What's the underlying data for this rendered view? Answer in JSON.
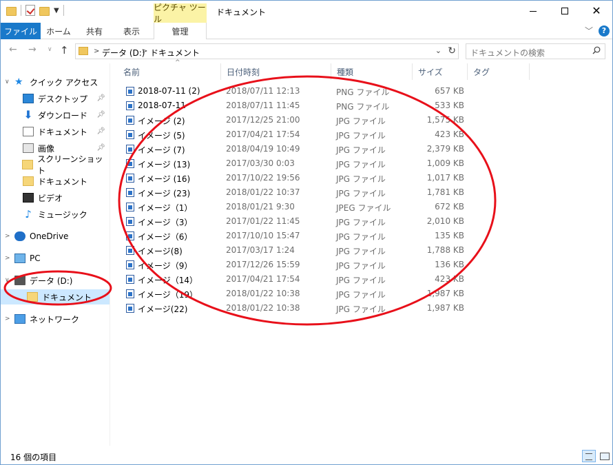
{
  "window": {
    "title": "ドキュメント",
    "context_tab": "ピクチャ ツール"
  },
  "ribbon": {
    "tabs": [
      "ファイル",
      "ホーム",
      "共有",
      "表示",
      "管理"
    ]
  },
  "address": {
    "crumbs": [
      "データ (D:)",
      "ドキュメント"
    ],
    "search_placeholder": "ドキュメントの検索"
  },
  "nav": {
    "quick_access": "クイック アクセス",
    "items": [
      {
        "label": "デスクトップ",
        "icon": "desktop-icon",
        "pinned": true
      },
      {
        "label": "ダウンロード",
        "icon": "download-icon",
        "pinned": true
      },
      {
        "label": "ドキュメント",
        "icon": "document-icon",
        "pinned": true
      },
      {
        "label": "画像",
        "icon": "pictures-icon",
        "pinned": true
      },
      {
        "label": "スクリーンショット",
        "icon": "folder-icon",
        "pinned": false
      },
      {
        "label": "ドキュメント",
        "icon": "folder-icon",
        "pinned": false
      },
      {
        "label": "ビデオ",
        "icon": "video-icon",
        "pinned": false
      },
      {
        "label": "ミュージック",
        "icon": "music-icon",
        "pinned": false
      }
    ],
    "onedrive": "OneDrive",
    "pc": "PC",
    "drive": "データ (D:)",
    "drive_child": "ドキュメント",
    "network": "ネットワーク"
  },
  "columns": {
    "name": "名前",
    "date": "日付時刻",
    "type": "種類",
    "size": "サイズ",
    "tag": "タグ"
  },
  "files": [
    {
      "name": "2018-07-11 (2)",
      "date": "2018/07/11 12:13",
      "type": "PNG ファイル",
      "size": "657 KB"
    },
    {
      "name": "2018-07-11",
      "date": "2018/07/11 11:45",
      "type": "PNG ファイル",
      "size": "533 KB"
    },
    {
      "name": "イメージ (2)",
      "date": "2017/12/25 21:00",
      "type": "JPG ファイル",
      "size": "1,575 KB"
    },
    {
      "name": "イメージ (5)",
      "date": "2017/04/21 17:54",
      "type": "JPG ファイル",
      "size": "423 KB"
    },
    {
      "name": "イメージ (7)",
      "date": "2018/04/19 10:49",
      "type": "JPG ファイル",
      "size": "2,379 KB"
    },
    {
      "name": "イメージ (13)",
      "date": "2017/03/30 0:03",
      "type": "JPG ファイル",
      "size": "1,009 KB"
    },
    {
      "name": "イメージ (16)",
      "date": "2017/10/22 19:56",
      "type": "JPG ファイル",
      "size": "1,017 KB"
    },
    {
      "name": "イメージ (23)",
      "date": "2018/01/22 10:37",
      "type": "JPG ファイル",
      "size": "1,781 KB"
    },
    {
      "name": "イメージ（1）",
      "date": "2018/01/21 9:30",
      "type": "JPEG ファイル",
      "size": "672 KB"
    },
    {
      "name": "イメージ（3）",
      "date": "2017/01/22 11:45",
      "type": "JPG ファイル",
      "size": "2,010 KB"
    },
    {
      "name": "イメージ（6）",
      "date": "2017/10/10 15:47",
      "type": "JPG ファイル",
      "size": "135 KB"
    },
    {
      "name": "イメージ(8)",
      "date": "2017/03/17 1:24",
      "type": "JPG ファイル",
      "size": "1,788 KB"
    },
    {
      "name": "イメージ（9）",
      "date": "2017/12/26 15:59",
      "type": "JPG ファイル",
      "size": "136 KB"
    },
    {
      "name": "イメージ（14）",
      "date": "2017/04/21 17:54",
      "type": "JPG ファイル",
      "size": "423 KB"
    },
    {
      "name": "イメージ（19）",
      "date": "2018/01/22 10:38",
      "type": "JPG ファイル",
      "size": "1,987 KB"
    },
    {
      "name": "イメージ(22)",
      "date": "2018/01/22 10:38",
      "type": "JPG ファイル",
      "size": "1,987 KB"
    }
  ],
  "status": {
    "count": "16 個の項目"
  },
  "colors": {
    "accent": "#1979ca",
    "context_tab": "#fbf3a6",
    "selection": "#cce8ff",
    "annotation": "#e8101a"
  }
}
